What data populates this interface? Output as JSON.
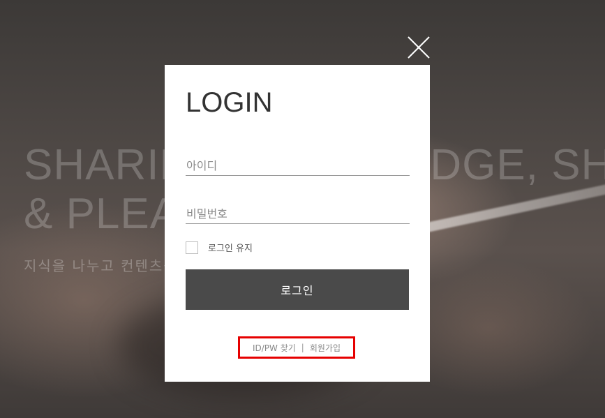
{
  "background": {
    "headline_line1": "SHARING KNOWLEDGE, SHARING.",
    "headline_line2": "& PLEASURE",
    "subtext": "지식을 나누고 컨텐츠를 즐기다"
  },
  "close_icon": "close-icon",
  "login": {
    "title": "LOGIN",
    "id_placeholder": "아이디",
    "id_value": "",
    "pw_placeholder": "비밀번호",
    "pw_value": "",
    "remember_label": "로그인 유지",
    "remember_checked": false,
    "submit_label": "로그인",
    "find_link": "ID/PW 찾기",
    "separator": "|",
    "signup_link": "회원가입"
  },
  "colors": {
    "button_bg": "#4a4a4a",
    "highlight_border": "#e60000",
    "modal_bg": "#ffffff"
  }
}
